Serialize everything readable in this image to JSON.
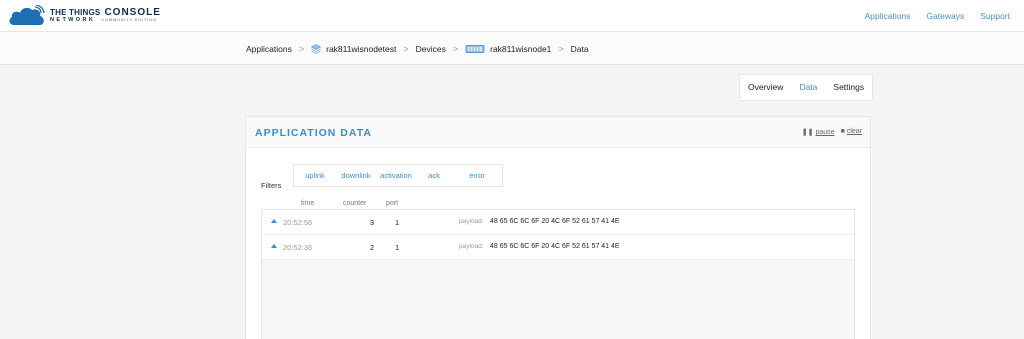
{
  "brand": {
    "line1": "THE THINGS",
    "console": "CONSOLE",
    "line2": "NETWORK",
    "edition": "COMMUNITY EDITION",
    "color": "#0d2b4b"
  },
  "topnav": [
    "Applications",
    "Gateways",
    "Support"
  ],
  "breadcrumb": {
    "items": [
      "Applications",
      "rak811wisnodetest",
      "Devices",
      "rak811wisnode1",
      "Data"
    ],
    "separator": ">"
  },
  "tabs": [
    {
      "label": "Overview",
      "active": false
    },
    {
      "label": "Data",
      "active": true
    },
    {
      "label": "Settings",
      "active": false
    }
  ],
  "panel": {
    "title": "APPLICATION DATA",
    "pause_label": "pause",
    "clear_label": "clear",
    "filters_label": "Filters",
    "filters": [
      "uplink",
      "downlink",
      "activation",
      "ack",
      "error"
    ],
    "columns": [
      "time",
      "counter",
      "port"
    ],
    "payload_label": "payload:"
  },
  "rows": [
    {
      "time": "20:52:56",
      "counter": "3",
      "port": "1",
      "payload": "48 65 6C 6C 6F 20 4C 6F 52 61 57 41 4E"
    },
    {
      "time": "20:52:36",
      "counter": "2",
      "port": "1",
      "payload": "48 65 6C 6C 6F 20 4C 6F 52 61 57 41 4E"
    }
  ],
  "colors": {
    "accent": "#3a8cc9",
    "link": "#4c8fc5"
  }
}
